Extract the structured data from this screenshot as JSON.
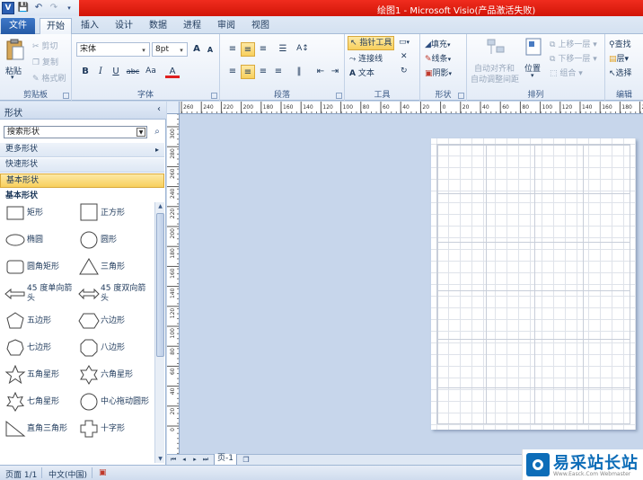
{
  "window": {
    "title": "绘图1 - Microsoft Visio(产品激活失败)"
  },
  "quick_access": [
    "save-icon",
    "undo-icon",
    "redo-icon"
  ],
  "tabs": [
    {
      "label": "文件"
    },
    {
      "label": "开始"
    },
    {
      "label": "插入"
    },
    {
      "label": "设计"
    },
    {
      "label": "数据"
    },
    {
      "label": "进程"
    },
    {
      "label": "审阅"
    },
    {
      "label": "视图"
    }
  ],
  "ribbon": {
    "clipboard": {
      "label": "剪贴板",
      "paste": "粘贴",
      "cut": "剪切",
      "copy": "复制",
      "format_painter": "格式刷"
    },
    "font": {
      "label": "字体",
      "font_name": "宋体",
      "font_size": "8pt",
      "bold": "B",
      "italic": "I",
      "underline": "U",
      "strike": "abc",
      "case": "Aa",
      "grow": "A",
      "shrink": "A",
      "color": "A"
    },
    "paragraph": {
      "label": "段落"
    },
    "tools": {
      "label": "工具",
      "pointer": "指针工具",
      "connector": "连接线",
      "text": "文本"
    },
    "shape": {
      "label": "形状",
      "fill": "填充",
      "line": "线条",
      "shadow": "阴影"
    },
    "arrange": {
      "label": "排列",
      "auto_align": "自动对齐和",
      "auto_align2": "自动调整间距",
      "position": "位置",
      "bring_forward": "上移一层",
      "send_backward": "下移一层",
      "group": "组合"
    },
    "editing": {
      "label": "编辑",
      "find": "查找",
      "layers": "层",
      "select": "选择"
    }
  },
  "shapes_pane": {
    "title": "形状",
    "search_placeholder": "搜索形状",
    "more_shapes": "更多形状",
    "quick_shapes": "快速形状",
    "basic_shapes": "基本形状",
    "stencil_title": "基本形状",
    "masters": [
      {
        "label": "矩形",
        "icon": "rectangle-icon"
      },
      {
        "label": "正方形",
        "icon": "square-icon"
      },
      {
        "label": "椭圆",
        "icon": "ellipse-icon"
      },
      {
        "label": "圆形",
        "icon": "circle-icon"
      },
      {
        "label": "圆角矩形",
        "icon": "rounded-rectangle-icon"
      },
      {
        "label": "三角形",
        "icon": "triangle-icon"
      },
      {
        "label": "45 度单向箭头",
        "icon": "single-arrow-icon"
      },
      {
        "label": "45 度双向箭头",
        "icon": "double-arrow-icon"
      },
      {
        "label": "五边形",
        "icon": "pentagon-icon"
      },
      {
        "label": "六边形",
        "icon": "hexagon-icon"
      },
      {
        "label": "七边形",
        "icon": "heptagon-icon"
      },
      {
        "label": "八边形",
        "icon": "octagon-icon"
      },
      {
        "label": "五角星形",
        "icon": "five-point-star-icon"
      },
      {
        "label": "六角星形",
        "icon": "six-point-star-icon"
      },
      {
        "label": "七角星形",
        "icon": "seven-point-star-icon"
      },
      {
        "label": "中心拖动圆形",
        "icon": "center-drag-circle-icon"
      },
      {
        "label": "直角三角形",
        "icon": "right-triangle-icon"
      },
      {
        "label": "十字形",
        "icon": "cross-icon"
      }
    ]
  },
  "ruler": {
    "h_labels": [
      "260",
      "240",
      "220",
      "200",
      "180",
      "160",
      "140",
      "120",
      "100",
      "80",
      "60",
      "40",
      "20",
      "0",
      "20",
      "40",
      "60",
      "80",
      "100",
      "120",
      "140",
      "160",
      "180",
      "200"
    ],
    "v_labels": [
      "300",
      "280",
      "260",
      "240",
      "220",
      "200",
      "180",
      "160",
      "140",
      "120",
      "100",
      "80",
      "60",
      "40",
      "20",
      "0"
    ]
  },
  "page_tabs": {
    "current": "页-1"
  },
  "status": {
    "page": "页面 1/1",
    "language": "中文(中国)"
  },
  "watermark": {
    "text": "易采站长站",
    "sub": "Www.Easck.Com Webmaster"
  }
}
